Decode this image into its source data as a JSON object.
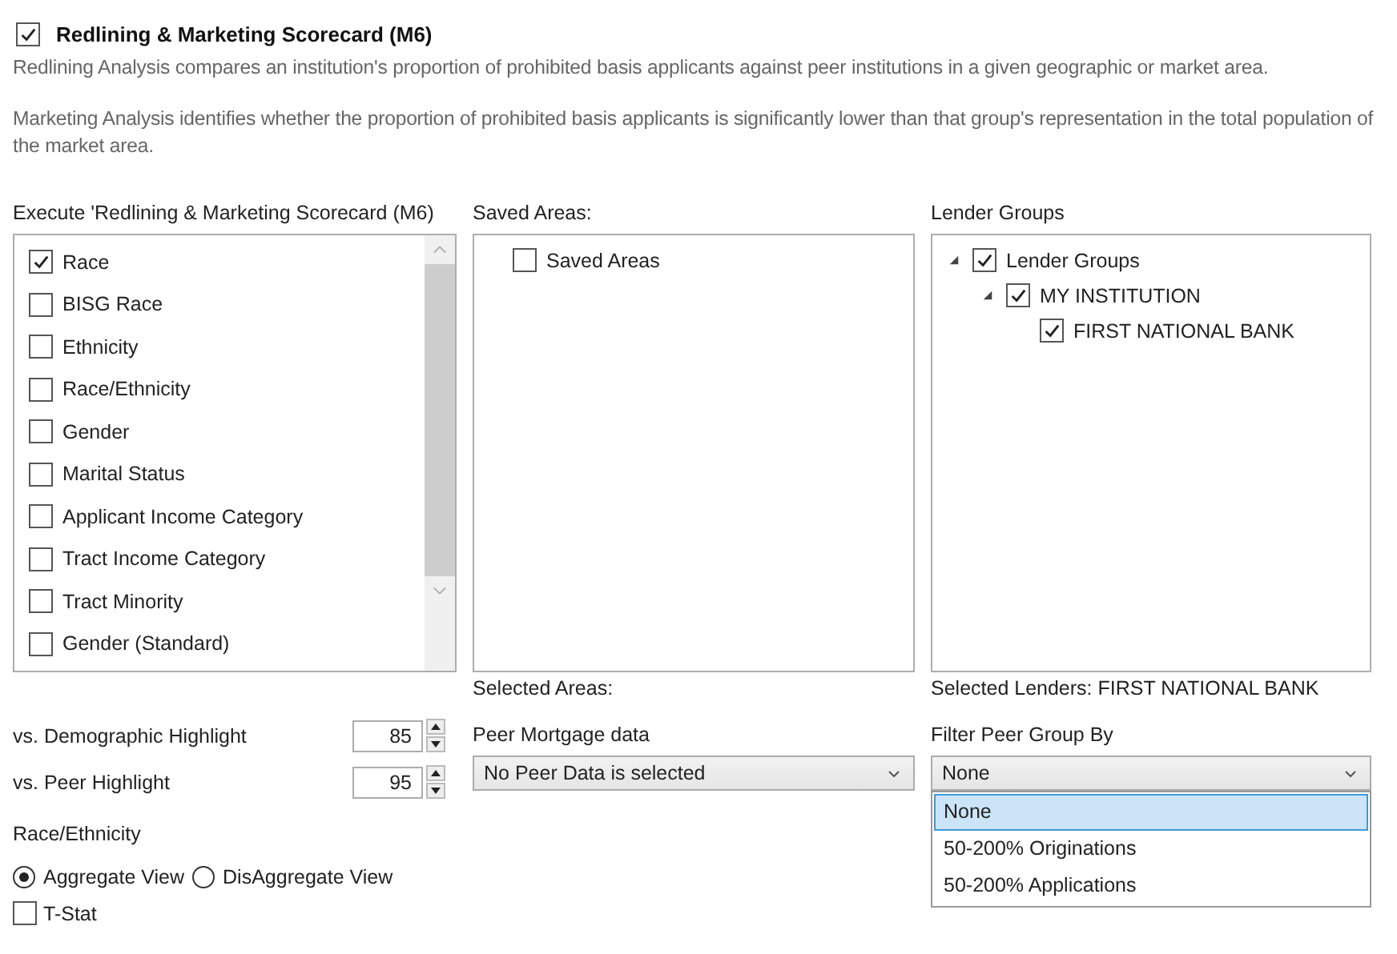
{
  "section": {
    "title": "Redlining & Marketing Scorecard (M6)",
    "checked": true,
    "descriptions": [
      "Redlining Analysis compares an institution's proportion of prohibited basis applicants against peer institutions in a given geographic or market area.",
      "Marketing Analysis identifies whether the proportion of prohibited basis applicants is significantly lower than that group's representation in the total population of the market area."
    ]
  },
  "execute_list": {
    "label": "Execute 'Redlining & Marketing Scorecard (M6)",
    "items": [
      {
        "label": "Race",
        "checked": true
      },
      {
        "label": "BISG Race",
        "checked": false
      },
      {
        "label": "Ethnicity",
        "checked": false
      },
      {
        "label": "Race/Ethnicity",
        "checked": false
      },
      {
        "label": "Gender",
        "checked": false
      },
      {
        "label": "Marital Status",
        "checked": false
      },
      {
        "label": "Applicant Income Category",
        "checked": false
      },
      {
        "label": "Tract Income Category",
        "checked": false
      },
      {
        "label": "Tract Minority",
        "checked": false
      },
      {
        "label": "Gender (Standard)",
        "checked": false
      }
    ]
  },
  "saved_areas": {
    "label": "Saved Areas:",
    "items": [
      {
        "label": "Saved Areas",
        "checked": false
      }
    ],
    "selected_label": "Selected Areas:"
  },
  "lender_groups": {
    "label": "Lender Groups",
    "tree": [
      {
        "label": "Lender Groups",
        "checked": true,
        "expanded": true,
        "children": [
          {
            "label": "MY INSTITUTION",
            "checked": true,
            "expanded": true,
            "children": [
              {
                "label": "FIRST NATIONAL BANK",
                "checked": true
              }
            ]
          }
        ]
      }
    ],
    "selected_label": "Selected Lenders: FIRST NATIONAL BANK"
  },
  "highlights": [
    {
      "label": "vs. Demographic Highlight",
      "value": "85"
    },
    {
      "label": "vs. Peer Highlight",
      "value": "95"
    }
  ],
  "peer_mortgage": {
    "label": "Peer Mortgage data",
    "value": "No Peer Data is selected"
  },
  "filter_peer_group": {
    "label": "Filter Peer Group By",
    "value": "None",
    "expanded": true,
    "options": [
      {
        "label": "None",
        "selected": true
      },
      {
        "label": "50-200% Originations",
        "selected": false
      },
      {
        "label": "50-200% Applications",
        "selected": false
      }
    ]
  },
  "race_ethnicity": {
    "label": "Race/Ethnicity",
    "options": [
      {
        "label": "Aggregate View",
        "selected": true
      },
      {
        "label": "DisAggregate View",
        "selected": false
      }
    ]
  },
  "t_stat": {
    "label": "T-Stat",
    "checked": false
  }
}
